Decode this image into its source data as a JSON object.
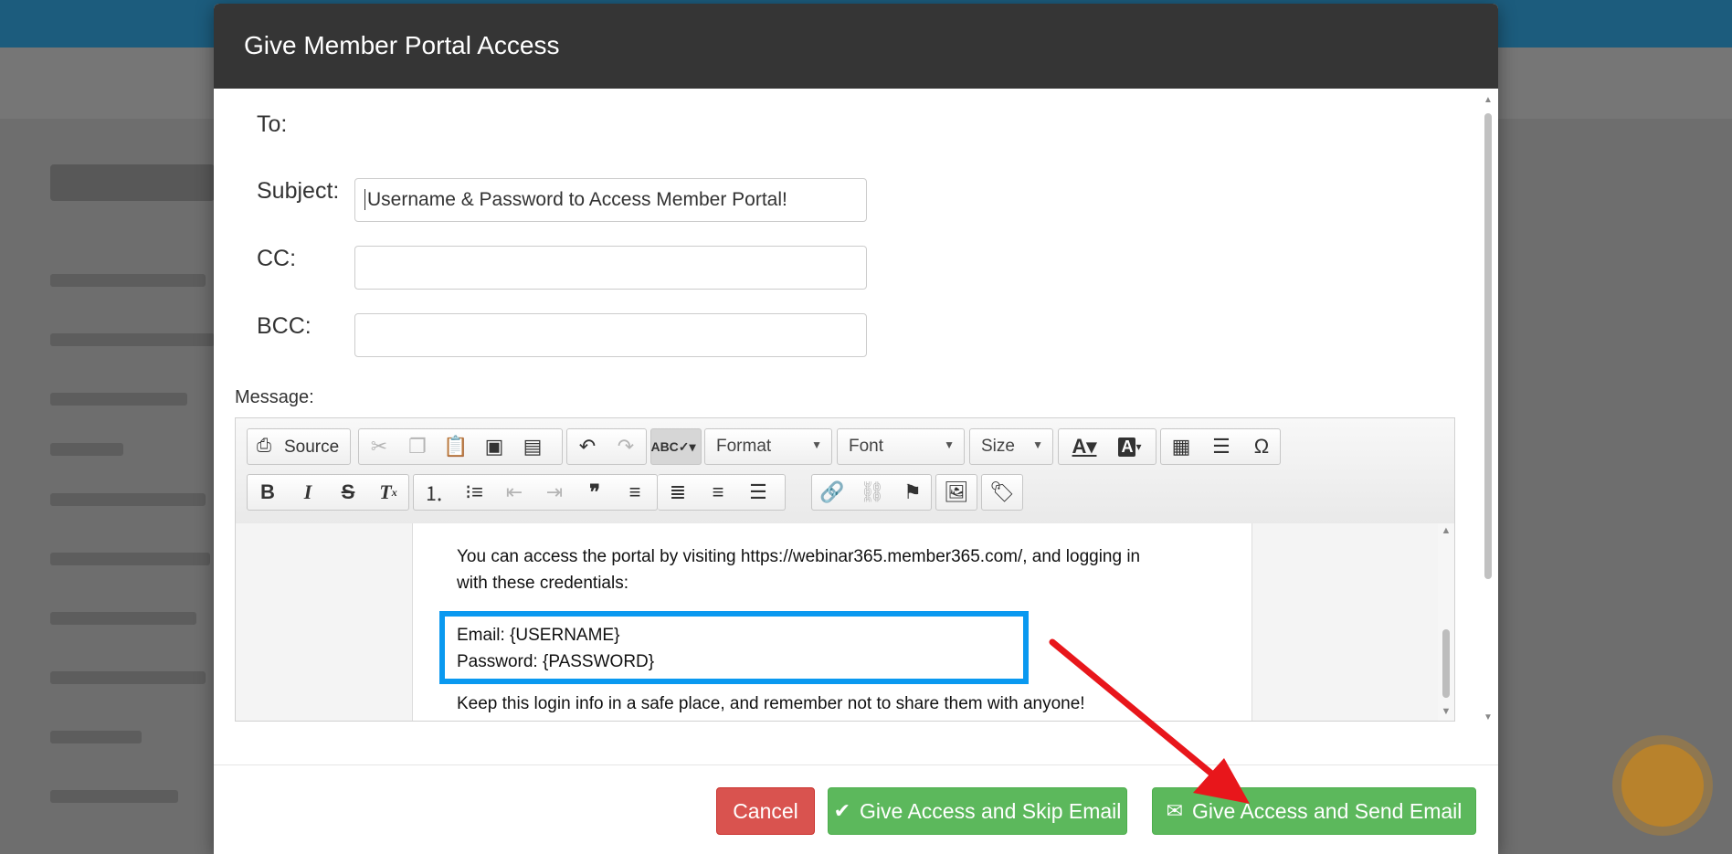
{
  "modal": {
    "title": "Give Member Portal Access"
  },
  "form": {
    "to_label": "To:",
    "subject_label": "Subject:",
    "subject_value": "Username & Password to Access Member Portal!",
    "cc_label": "CC:",
    "cc_value": "",
    "bcc_label": "BCC:",
    "bcc_value": "",
    "message_label": "Message:"
  },
  "editor": {
    "source_label": "Source",
    "format_label": "Format",
    "font_label": "Font",
    "size_label": "Size",
    "icons_row1": [
      "source-icon",
      "cut-icon",
      "copy-icon",
      "paste-icon",
      "paste-text-icon",
      "paste-word-icon",
      "undo-icon",
      "redo-icon",
      "spellcheck-icon",
      "text-color-icon",
      "background-color-icon",
      "table-icon",
      "horizontal-line-icon",
      "special-char-icon"
    ],
    "icons_row2": [
      "bold-icon",
      "italic-icon",
      "strike-icon",
      "remove-format-icon",
      "numbered-list-icon",
      "bulleted-list-icon",
      "outdent-icon",
      "indent-icon",
      "blockquote-icon",
      "align-left-icon",
      "align-center-icon",
      "align-right-icon",
      "justify-icon",
      "link-icon",
      "unlink-icon",
      "anchor-icon",
      "image-icon",
      "tag-icon"
    ],
    "content": {
      "line1": "You can access the portal by visiting https://webinar365.member365.com/, and logging in",
      "line2": "with these credentials:",
      "email_line": "Email: {USERNAME}",
      "password_line": "Password: {PASSWORD}",
      "keep_line": "Keep this login info in a safe place, and remember not to share them with anyone!"
    }
  },
  "buttons": {
    "cancel": "Cancel",
    "skip": "Give Access and Skip Email",
    "send": "Give Access and Send Email"
  },
  "colors": {
    "header_bg": "#353535",
    "cancel": "#d9534f",
    "success": "#5cb85c",
    "highlight_box": "#0a99f0",
    "annotation_arrow": "#e8161b"
  }
}
